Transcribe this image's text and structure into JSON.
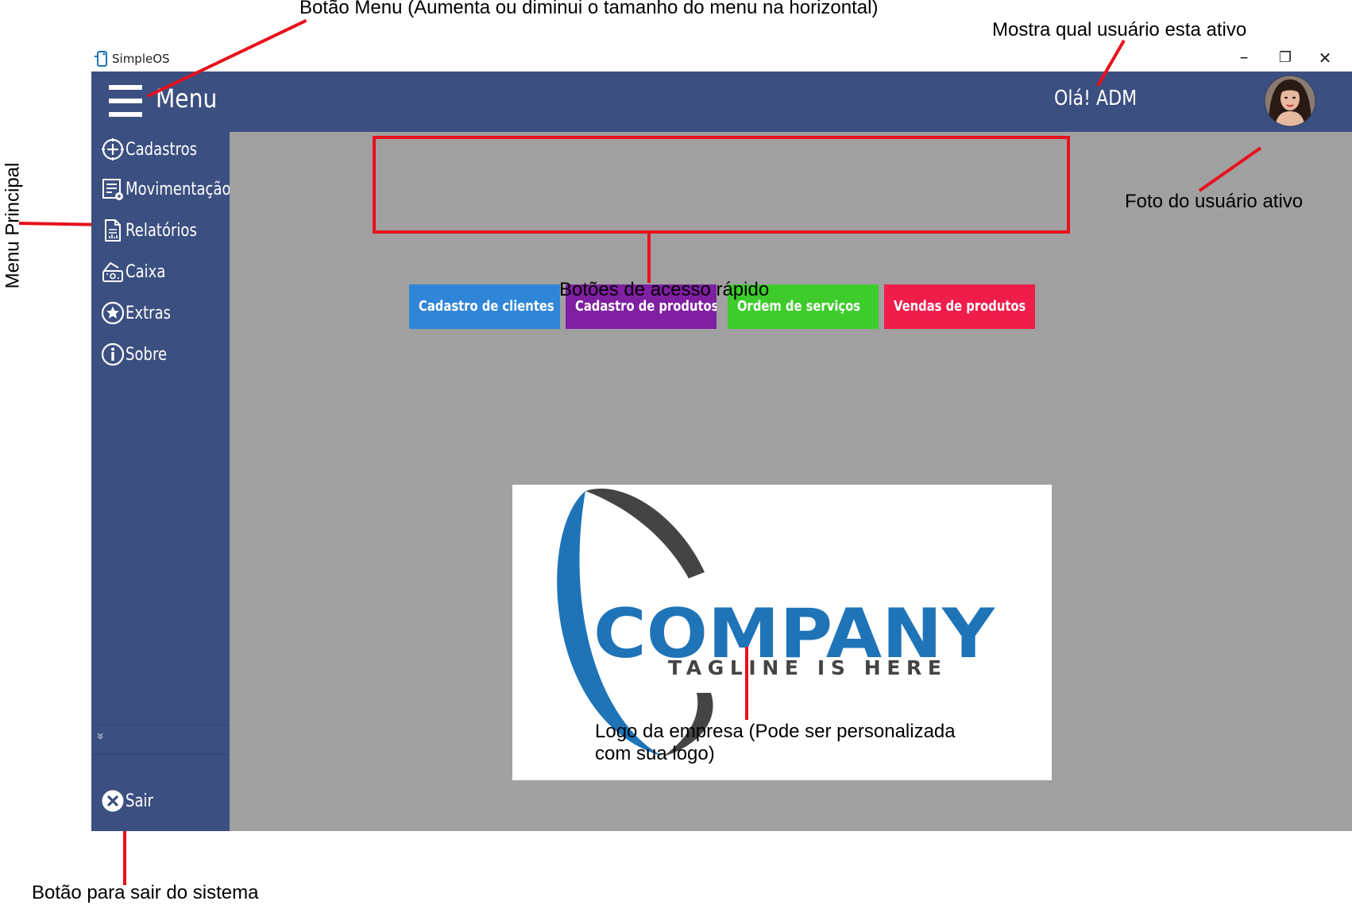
{
  "window": {
    "app_title": "SimpleOS",
    "minimize_label": "–",
    "restore_label": "❐",
    "close_label": "✕"
  },
  "appbar": {
    "menu_label": "Menu",
    "greeting": "Olá! ADM"
  },
  "sidebar": {
    "items": [
      {
        "label": "Cadastros",
        "icon": "plus-circle-icon"
      },
      {
        "label": "Movimentação",
        "icon": "list-icon"
      },
      {
        "label": "Relatórios",
        "icon": "report-icon"
      },
      {
        "label": "Caixa",
        "icon": "cash-register-icon"
      },
      {
        "label": "Extras",
        "icon": "star-circle-icon"
      },
      {
        "label": "Sobre",
        "icon": "info-circle-icon"
      }
    ],
    "expand_glyph": "»",
    "exit_label": "Sair"
  },
  "quick_access": [
    {
      "label": "Cadastro de clientes",
      "color": "#2f86d8"
    },
    {
      "label": "Cadastro de produtos",
      "color": "#7f1fa2"
    },
    {
      "label": "Ordem de serviços",
      "color": "#3dcc2b"
    },
    {
      "label": "Vendas de produtos",
      "color": "#f01c4a"
    }
  ],
  "logo": {
    "name": "COMPANY",
    "tagline": "TAGLINE IS HERE"
  },
  "annotations": {
    "menu_button": "Botão Menu (Aumenta ou diminui o tamanho do menu na horizontal)",
    "active_user": "Mostra qual usuário esta ativo",
    "user_photo": "Foto do usuário ativo",
    "main_menu": "Menu Principal",
    "quick_buttons": "Botões de acesso rápido",
    "company_logo_line1": "Logo da empresa (Pode ser personalizada",
    "company_logo_line2": "com sua logo)",
    "exit_button": "Botão para sair do sistema"
  },
  "colors": {
    "appbar": "#3b4f80",
    "content_bg": "#a0a0a0",
    "annotation": "#e8101c",
    "logo_blue": "#1f74b8",
    "logo_dark": "#444444"
  }
}
